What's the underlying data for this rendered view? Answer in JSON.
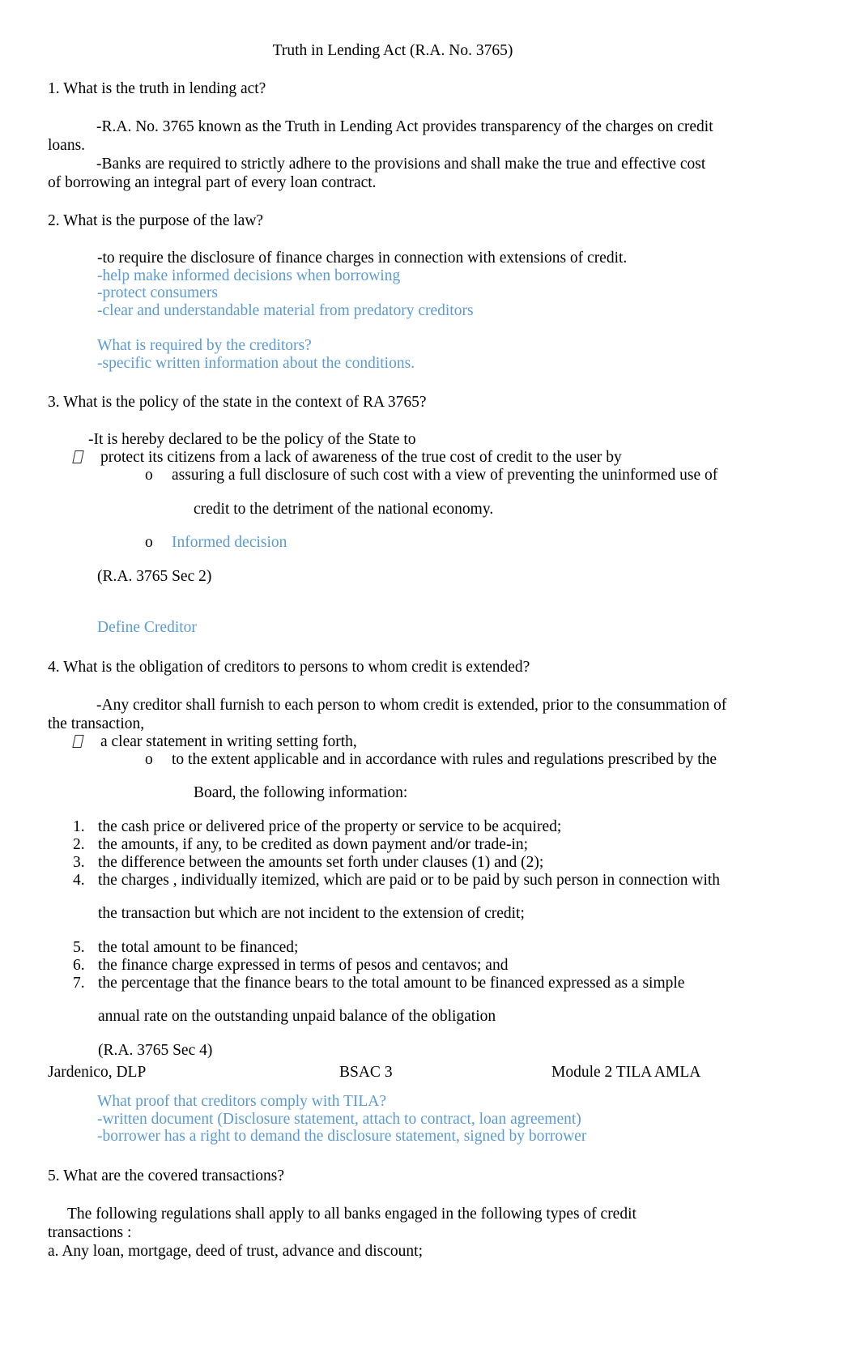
{
  "document": {
    "title": "Truth in Lending Act (R.A. No. 3765)",
    "accent_blue": "#5b9bd5",
    "text_color": "#000000"
  },
  "sections": {
    "q1": {
      "heading": "1. What is the truth in lending act?",
      "a1_line1": "-R.A. No. 3765 known as the Truth in Lending Act provides        transparency      of the charges on credit",
      "a1_line2": "loans.",
      "a2_line1": "-Banks are required to     strictly   adhere to the provisions and shall make the true and effective cost",
      "a2_line2": "of borrowing an integral part of every loan contract."
    },
    "q2": {
      "heading": "2. What is the purpose of the law?",
      "a1": "-to require the disclosure        of finance charges in connection with extensions of credit.",
      "b1": "-help make informed decisions when borrowing",
      "b2": "-protect consumers",
      "b3": "-clear and understandable material from predatory creditors",
      "b4": "What is required by the creditors?",
      "b5": "-specific written information about the conditions."
    },
    "q3": {
      "heading": "3.  What is the policy of the state in the context of RA 3765?",
      "lead": "-It is hereby declared to be the policy of the State to",
      "bullet_marker": "tofu-box-glyph",
      "bullet": "protect   its citizens from a lack of    awareness    of the true cost of credit to the user by",
      "sub_marker": "o",
      "sub1_line1": "assuring a   full disclosure     of such cost with a view of preventing the uninformed use of",
      "sub1_line2": "credit to the detriment of the national economy.",
      "sub2": "Informed decision",
      "ref": "(R.A. 3765 Sec 2)",
      "note": "Define Creditor"
    },
    "q4": {
      "heading": "4.  What is the obligation of creditors to persons to whom credit is extended?",
      "a1_line1": "-Any creditor shall   furnish   to each person to whom credit is extended, prior to the consummation of",
      "a1_line2": "the transaction,",
      "bullet_marker": "tofu-box-glyph",
      "bullet": "a  clear statement       in writing setting forth,",
      "sub_marker": "o",
      "sub_line1": "to the extent applicable and in accordance with rules and regulations prescribed by the",
      "sub_line2": "Board, the following information:",
      "items": [
        {
          "num": "1.",
          "text": "the  cash price or delivered price        of the property or service to be acquired;"
        },
        {
          "num": "2.",
          "text": "the amounts, if any, to be credited as       down payment and/or trade-in;"
        },
        {
          "num": "3.",
          "text": "the  difference between the amounts          set forth under clauses (1) and (2);"
        },
        {
          "num": "4.",
          "text": "the  charges   , individually itemized, which are paid or to be paid by such person in connection with",
          "cont": "the transaction but which are not incident to the extension of credit;"
        },
        {
          "num": "5.",
          "text": "the  total amount     to be financed;"
        },
        {
          "num": "6.",
          "text": "the  finance charge      expressed in terms of pesos and centavos; and"
        },
        {
          "num": "7.",
          "text": "the  percentage     that the finance bears to the total amount to be financed expressed as a simple",
          "cont": "annual rate on the outstanding unpaid balance of the obligation"
        }
      ],
      "ref": "(R.A. 3765 Sec 4)",
      "blue1": "What proof that creditors comply with TILA?",
      "blue2": "-written document (Disclosure statement, attach to contract, loan agreement)",
      "blue3": "-borrower has a right to demand the disclosure statement, signed by borrower"
    },
    "q5": {
      "heading": "5.  What are the covered transactions?",
      "a1_line1": "The  following  regulations  shall  apply  to  all  banks  engaged  in  the  following         types  of  credit",
      "a1_line2": "transactions    :",
      "item_a": " a. Any loan, mortgage, deed of trust, advance and discount;"
    }
  },
  "footer": {
    "left": "Jardenico, DLP",
    "middle": "BSAC 3",
    "right": "Module 2 TILA AMLA"
  }
}
